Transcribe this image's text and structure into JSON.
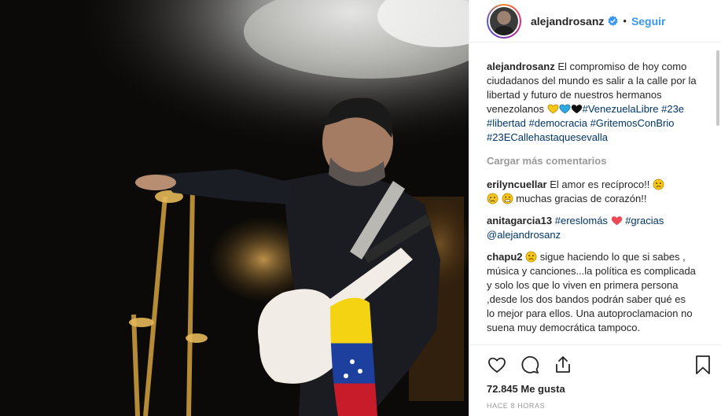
{
  "post": {
    "username": "alejandrosanz",
    "dot": "•",
    "follow_label": "Seguir",
    "caption": {
      "username": "alejandrosanz",
      "text": "El compromiso de hoy como ciudadanos del mundo es salir a la calle por la libertad y futuro de nuestros hermanos venezolanos",
      "hashtags": [
        "#VenezuelaLibre",
        "#23e",
        "#libertad",
        "#democracia",
        "#GritemosConBrio",
        "#23ECallehastaquesevalla"
      ]
    },
    "load_more": "Cargar más comentarios",
    "comments": [
      {
        "user": "erilyncuellar",
        "text_a": "El amor es recíproco!!",
        "text_b": "muchas gracias de corazón!!"
      },
      {
        "user": "anitagarcia13",
        "tag_a": "#ereslomás",
        "tag_b": "#gracias",
        "mention": "@alejandrosanz"
      },
      {
        "user": "chapu2",
        "text": "sigue haciendo lo que si sabes , música y canciones...la política es complicada y solo los que lo viven en primera persona ,desde los dos bandos podrán saber qué es lo mejor para ellos. Una autoproclamacion no suena muy democrática tampoco."
      }
    ],
    "likes": "72.845 Me gusta",
    "timestamp": "HACE 8 HORAS"
  },
  "colors": {
    "link": "#3897f0",
    "tag": "#003569",
    "muted": "#999999",
    "heart": "#ed4956"
  },
  "icons": [
    "verified-icon",
    "heart-icon",
    "comment-icon",
    "share-icon",
    "bookmark-icon"
  ]
}
